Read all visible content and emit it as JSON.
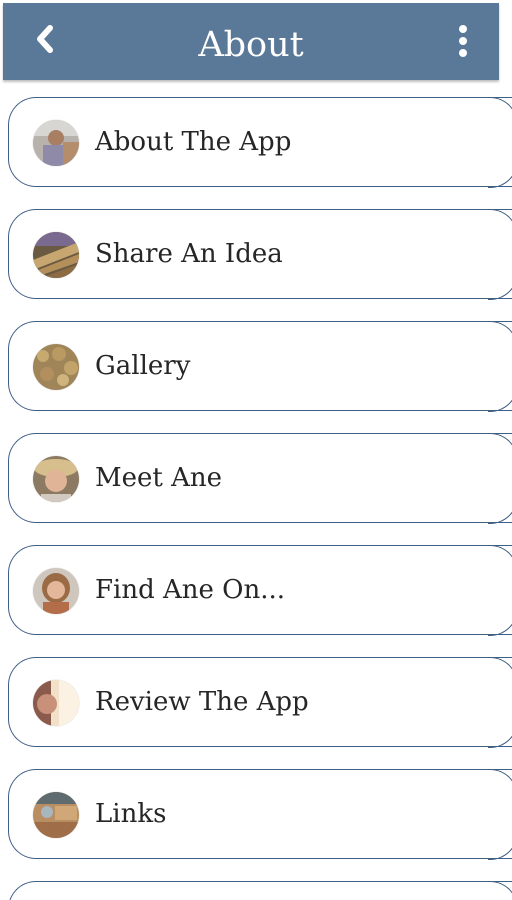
{
  "header": {
    "title": "About",
    "back_icon": "chevron-left-icon",
    "more_icon": "more-vertical-icon",
    "background_color": "#5a7898"
  },
  "menu": {
    "items": [
      {
        "label": "About The App"
      },
      {
        "label": "Share An Idea"
      },
      {
        "label": "Gallery"
      },
      {
        "label": "Meet Ane"
      },
      {
        "label": "Find Ane On..."
      },
      {
        "label": "Review The App"
      },
      {
        "label": "Links"
      }
    ],
    "border_color": "#3f5f86"
  }
}
